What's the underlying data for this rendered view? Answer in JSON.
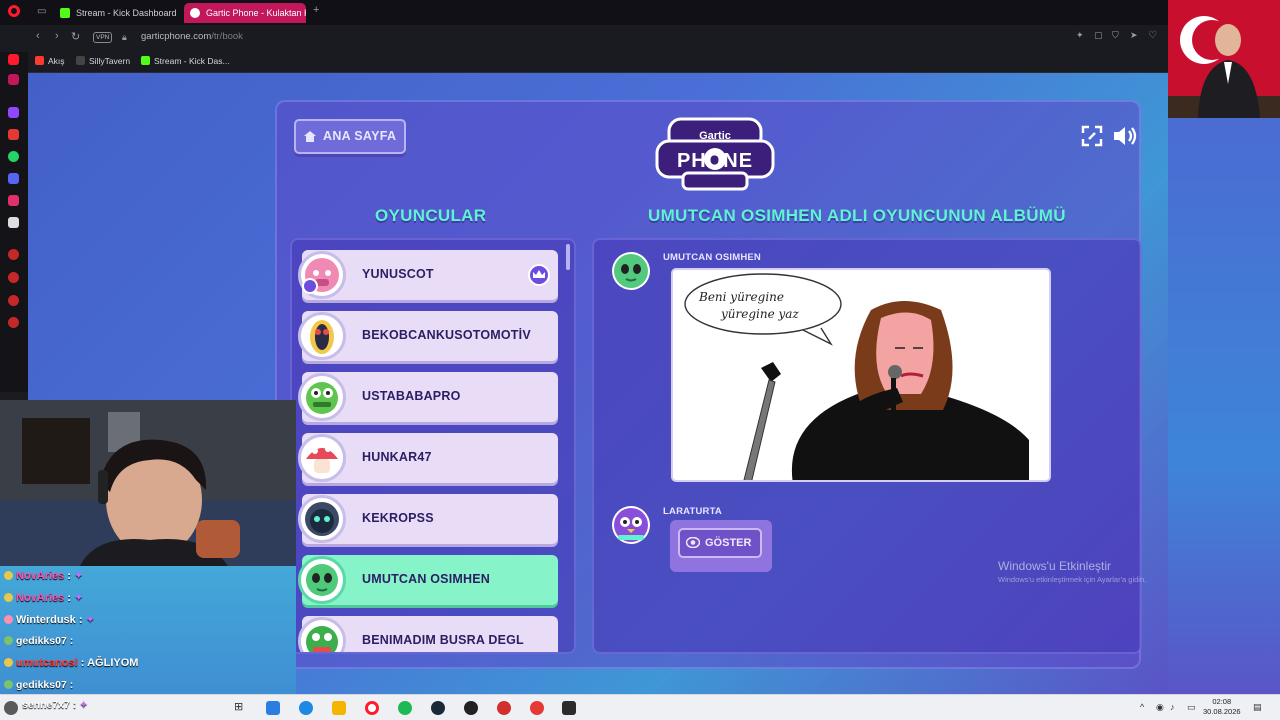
{
  "browser": {
    "tabs": [
      {
        "label": "Stream - Kick Dashboard",
        "color": "#53fc18"
      },
      {
        "label": "Gartic Phone - Kulaktan Ku",
        "color": "#ffffff"
      }
    ],
    "new_tab": "+",
    "vpn": "VPN",
    "url_host": "garticphone.com",
    "url_path": "/tr/book",
    "bookmarks": [
      {
        "label": "Akış",
        "color": "#ff3b30"
      },
      {
        "label": "SillyTavern",
        "color": "#444444"
      },
      {
        "label": "Stream - Kick Das...",
        "color": "#53fc18"
      }
    ]
  },
  "game": {
    "home_label": "ANA SAYFA",
    "logo_top": "Gartic",
    "logo_main": "PHONE",
    "players_title": "OYUNCULAR",
    "album_title": "UMUTCAN OSIMHEN ADLI OYUNCUNUN ALBÜMÜ",
    "players": [
      {
        "name": "YUNUSCOT",
        "avatar_color": "#f08ab4"
      },
      {
        "name": "BEKOBCANKUSOTOMOTİV",
        "avatar_color": "#f2c84b"
      },
      {
        "name": "USTABABAPRO",
        "avatar_color": "#5fc54f"
      },
      {
        "name": "HUNKAR47",
        "avatar_color": "#e8495a"
      },
      {
        "name": "KEKROPSS",
        "avatar_color": "#3a4a66"
      },
      {
        "name": "UMUTCAN OSIMHEN",
        "avatar_color": "#4fc97a"
      },
      {
        "name": "BENIMADIM BUSRA DEGL",
        "avatar_color": "#3cae4c"
      }
    ],
    "active_player": "UMUTCAN OSIMHEN",
    "entries": [
      {
        "author": "UMUTCAN OSIMHEN",
        "avatar_color": "#52c97e"
      },
      {
        "author": "LARATURTA",
        "avatar_color": "#8a4fd8"
      }
    ],
    "drawing_text_line1": "Beni yüregine",
    "drawing_text_line2": "yüregine yaz",
    "show_label": "GÖSTER",
    "watermark": "Windows'u Etkinleştir",
    "watermark_sub": "Windows'u etkinleştirmek için Ayarlar'a gidin."
  },
  "chat": [
    {
      "user": "NovAries",
      "text": ":",
      "color": "#ff4fb0",
      "badge": "#e8c84b"
    },
    {
      "user": "NovAries",
      "text": ":",
      "color": "#ff4fb0",
      "badge": "#e8c84b"
    },
    {
      "user": "Winterdusk",
      "text": ":",
      "color": "#ffffff",
      "badge": "#ff8fb0"
    },
    {
      "user": "gedikks07",
      "text": ":",
      "color": "#ffffff",
      "badge": "#7ac26b"
    },
    {
      "user": "umutcanosl",
      "text": ": AĞLIYOM",
      "color": "#ff3a3a",
      "badge": "#e8c84b"
    },
    {
      "user": "gedikks07",
      "text": ":",
      "color": "#ffffff",
      "badge": "#7ac26b"
    },
    {
      "user": "senne7x7",
      "text": ":",
      "color": "#ffffff",
      "badge": "#ff4fb0"
    }
  ],
  "taskbar": {
    "time": "02:08",
    "date": "30.08.2026"
  }
}
